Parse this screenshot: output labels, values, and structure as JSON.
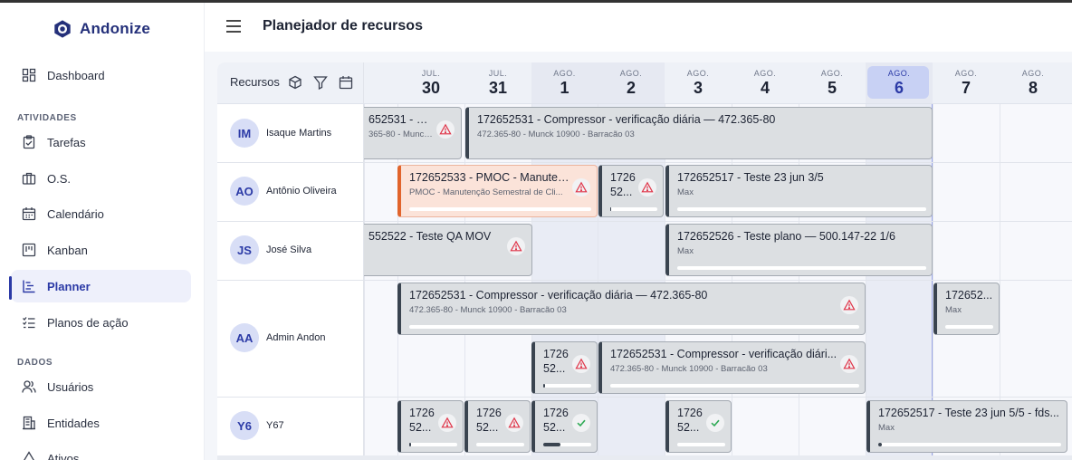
{
  "app": {
    "name": "Andonize"
  },
  "header": {
    "title": "Planejador de recursos"
  },
  "sidebar": {
    "items": [
      {
        "label": "Dashboard",
        "icon": "dashboard-icon"
      },
      {
        "label": "Tarefas",
        "icon": "clipboard-check-icon"
      },
      {
        "label": "O.S.",
        "icon": "briefcase-icon"
      },
      {
        "label": "Calendário",
        "icon": "calendar-icon"
      },
      {
        "label": "Kanban",
        "icon": "kanban-icon"
      },
      {
        "label": "Planner",
        "icon": "planner-icon",
        "active": true
      },
      {
        "label": "Planos de ação",
        "icon": "checklist-icon"
      },
      {
        "label": "Usuários",
        "icon": "users-icon"
      },
      {
        "label": "Entidades",
        "icon": "building-icon"
      },
      {
        "label": "Ativos",
        "icon": "asset-icon"
      }
    ],
    "sections": {
      "atividades": "ATIVIDADES",
      "dados": "DADOS"
    }
  },
  "planner": {
    "resources_label": "Recursos",
    "days": [
      {
        "mon": "JUL.",
        "num": "30"
      },
      {
        "mon": "JUL.",
        "num": "31"
      },
      {
        "mon": "AGO.",
        "num": "1"
      },
      {
        "mon": "AGO.",
        "num": "2"
      },
      {
        "mon": "AGO.",
        "num": "3"
      },
      {
        "mon": "AGO.",
        "num": "4"
      },
      {
        "mon": "AGO.",
        "num": "5"
      },
      {
        "mon": "AGO.",
        "num": "6",
        "today": true
      },
      {
        "mon": "AGO.",
        "num": "7"
      },
      {
        "mon": "AGO.",
        "num": "8"
      }
    ],
    "resources": [
      {
        "initials": "IM",
        "name": "Isaque Martins"
      },
      {
        "initials": "AO",
        "name": "Antônio Oliveira"
      },
      {
        "initials": "JS",
        "name": "José Silva"
      },
      {
        "initials": "AA",
        "name": "Admin Andon"
      },
      {
        "initials": "Y6",
        "name": "Y67"
      }
    ],
    "tasks": [
      {
        "title": "652531 - Co...",
        "sub": "365-80 - Munck ...",
        "status": "warning",
        "progress": 0
      },
      {
        "title": "172652531 - Compressor - verificação diária — 472.365-80",
        "sub": "472.365-80 - Munck 10900 - Barracão 03",
        "status": "none",
        "progress": 0
      },
      {
        "title": "172652533 - PMOC - Manuten...",
        "sub": "PMOC - Manutenção Semestral de Cli...",
        "status": "warning",
        "progress": 0,
        "alert": true
      },
      {
        "title": "1726 52...",
        "sub": "",
        "status": "warning",
        "progress": 2
      },
      {
        "title": "172652517 - Teste 23 jun 3/5",
        "sub": "Max",
        "status": "none",
        "progress": 0
      },
      {
        "title": "552522 - Teste QA MOV",
        "sub": "",
        "status": "warning",
        "progress": 0
      },
      {
        "title": "172652526 - Teste plano — 500.147-22 1/6",
        "sub": "Max",
        "status": "none",
        "progress": 0
      },
      {
        "title": "172652531 - Compressor - verificação diária — 472.365-80",
        "sub": "472.365-80 - Munck 10900 - Barracão 03",
        "status": "warning",
        "progress": 0
      },
      {
        "title": "172652...",
        "sub": "Max",
        "status": "none",
        "progress": 0
      },
      {
        "title": "1726 52...",
        "sub": "",
        "status": "warning",
        "progress": 3
      },
      {
        "title": "172652531 - Compressor - verificação diári...",
        "sub": "472.365-80 - Munck 10900 - Barracão 03",
        "status": "warning",
        "progress": 0
      },
      {
        "title": "1726 52...",
        "sub": "",
        "status": "warning",
        "progress": 4
      },
      {
        "title": "1726 52...",
        "sub": "",
        "status": "warning",
        "progress": 0
      },
      {
        "title": "1726 52...",
        "sub": "",
        "status": "done",
        "progress": 35
      },
      {
        "title": "1726 52...",
        "sub": "",
        "status": "done",
        "progress": 0
      },
      {
        "title": "172652517 - Teste 23 jun 5/5 - fds...",
        "sub": "Max",
        "status": "none",
        "progress": 2
      }
    ]
  },
  "colors": {
    "accent": "#2b3aa6",
    "today": "#c8d1f4",
    "alert": "#e1642c",
    "warning": "#e0364a",
    "done": "#2faa55"
  }
}
